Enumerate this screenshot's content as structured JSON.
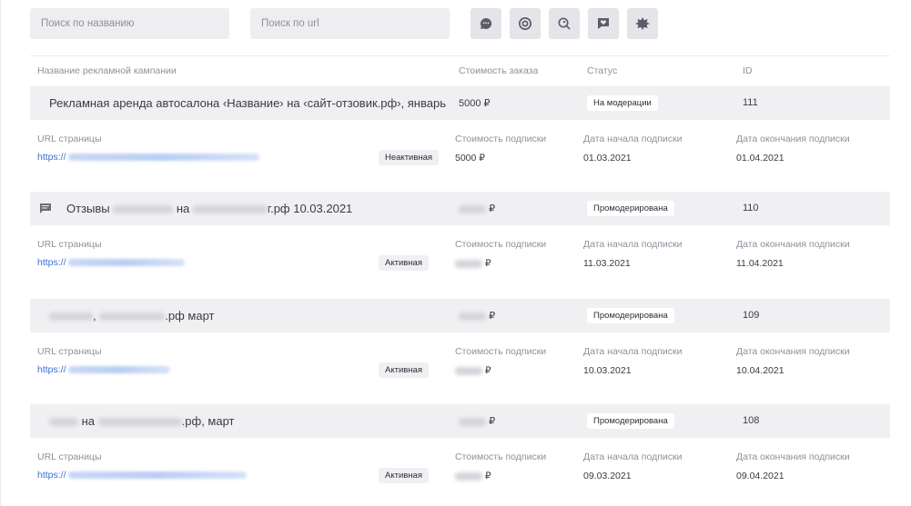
{
  "search": {
    "name_placeholder": "Поиск по названию",
    "url_placeholder": "Поиск по url"
  },
  "toolbar_icons": [
    "chat-bubble-icon",
    "target-icon",
    "zoom-search-icon",
    "heart-message-icon",
    "star-burst-icon"
  ],
  "columns": {
    "name": "Название рекламной кампании",
    "cost": "Стоимость заказа",
    "status": "Статус",
    "id": "ID"
  },
  "detail_labels": {
    "url": "URL страницы",
    "sub_cost": "Стоимость подписки",
    "start": "Дата начала подписки",
    "end": "Дата окончания подписки"
  },
  "campaigns": [
    {
      "title": "Рекламная аренда автосалона ‹Название› на ‹сайт-отзовик.рф›, январь",
      "cost": "5000 ₽",
      "status": "На модерации",
      "id": "111",
      "url_prefix": "https://",
      "state": "Неактивная",
      "sub_cost": "5000 ₽",
      "start": "01.03.2021",
      "end": "01.04.2021"
    },
    {
      "title_a": "Отзывы",
      "title_b": "на",
      "title_c": "г.рф 10.03.2021",
      "cost": "₽",
      "status": "Промодерирована",
      "id": "110",
      "url_prefix": "https://",
      "state": "Активная",
      "sub_cost": "₽",
      "start": "11.03.2021",
      "end": "11.04.2021"
    },
    {
      "title_a": ",",
      "title_c": ".рф март",
      "cost": "₽",
      "status": "Промодерирована",
      "id": "109",
      "url_prefix": "https://",
      "state": "Активная",
      "sub_cost": "₽",
      "start": "10.03.2021",
      "end": "10.04.2021"
    },
    {
      "title_b": "на",
      "title_c": ".рф, март",
      "cost": "₽",
      "status": "Промодерирована",
      "id": "108",
      "url_prefix": "https://",
      "state": "Активная",
      "sub_cost": "₽",
      "start": "09.03.2021",
      "end": "09.04.2021"
    }
  ]
}
